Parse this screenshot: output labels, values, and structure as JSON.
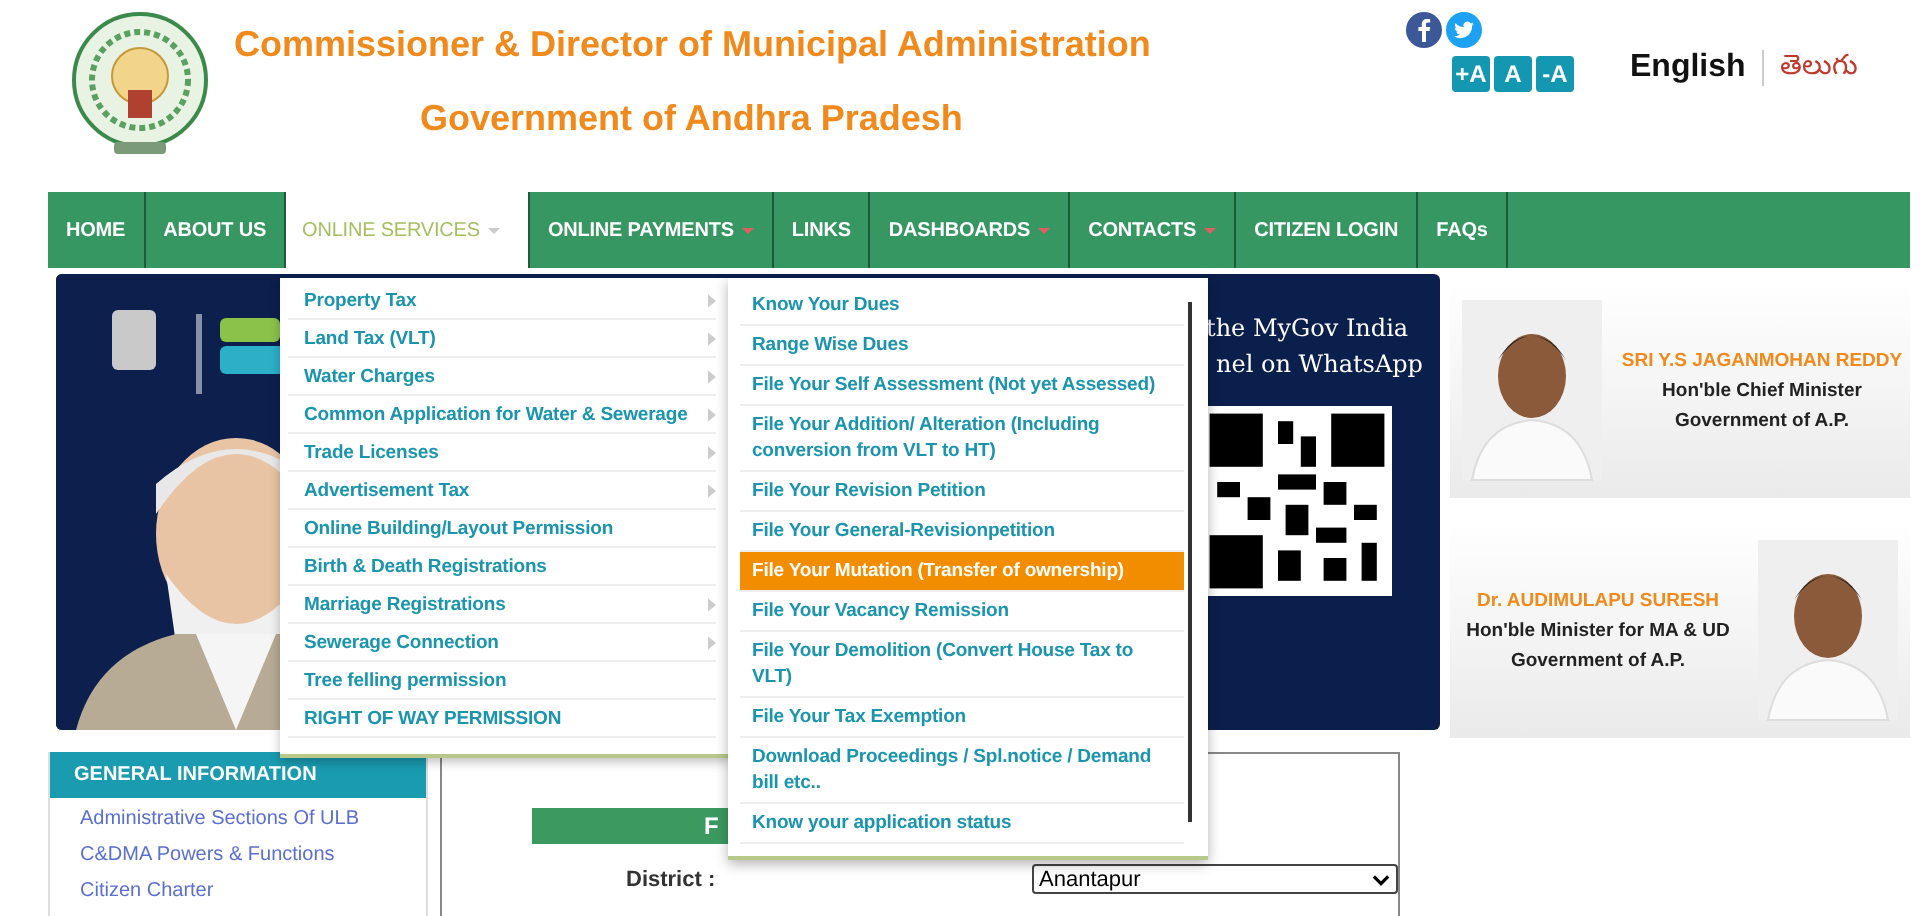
{
  "header": {
    "title": "Commissioner & Director of Municipal Administration",
    "subtitle": "Government of Andhra Pradesh",
    "font_buttons": [
      "+A",
      "A",
      "-A"
    ],
    "languages": [
      {
        "label": "English",
        "selected": true
      },
      {
        "label": "తెలుగు",
        "selected": false
      }
    ]
  },
  "nav": [
    {
      "label": "HOME",
      "selected": false,
      "has_dropdown": false
    },
    {
      "label": "ABOUT US",
      "selected": false,
      "has_dropdown": false
    },
    {
      "label": "ONLINE SERVICES",
      "selected": true,
      "has_dropdown": true
    },
    {
      "label": "ONLINE PAYMENTS",
      "selected": false,
      "has_dropdown": true
    },
    {
      "label": "LINKS",
      "selected": false,
      "has_dropdown": false
    },
    {
      "label": "DASHBOARDS",
      "selected": false,
      "has_dropdown": true
    },
    {
      "label": "CONTACTS",
      "selected": false,
      "has_dropdown": true
    },
    {
      "label": "CITIZEN LOGIN",
      "selected": false,
      "has_dropdown": false
    },
    {
      "label": "FAQs",
      "selected": false,
      "has_dropdown": false
    }
  ],
  "services_menu": [
    {
      "label": "Property Tax",
      "has_submenu": true
    },
    {
      "label": "Land Tax (VLT)",
      "has_submenu": true
    },
    {
      "label": "Water Charges",
      "has_submenu": true
    },
    {
      "label": "Common Application for Water & Sewerage",
      "has_submenu": true
    },
    {
      "label": "Trade Licenses",
      "has_submenu": true
    },
    {
      "label": "Advertisement Tax",
      "has_submenu": true
    },
    {
      "label": "Online Building/Layout Permission",
      "has_submenu": false
    },
    {
      "label": "Birth & Death Registrations",
      "has_submenu": false
    },
    {
      "label": "Marriage Registrations",
      "has_submenu": true
    },
    {
      "label": "Sewerage Connection",
      "has_submenu": true
    },
    {
      "label": "Tree felling permission",
      "has_submenu": false
    },
    {
      "label": "RIGHT OF WAY PERMISSION",
      "has_submenu": false
    }
  ],
  "property_tax_menu": [
    {
      "label": "Know Your Dues",
      "selected": false
    },
    {
      "label": "Range Wise Dues",
      "selected": false
    },
    {
      "label": "File Your Self Assessment (Not yet Assessed)",
      "selected": false
    },
    {
      "label": "File Your Addition/ Alteration (Including conversion from VLT to HT)",
      "selected": false
    },
    {
      "label": "File Your Revision Petition",
      "selected": false
    },
    {
      "label": "File Your General-Revisionpetition",
      "selected": false
    },
    {
      "label": "File Your Mutation (Transfer of ownership)",
      "selected": true
    },
    {
      "label": "File Your Vacancy Remission",
      "selected": false
    },
    {
      "label": "File Your Demolition (Convert House Tax to VLT)",
      "selected": false
    },
    {
      "label": "File Your Tax Exemption",
      "selected": false
    },
    {
      "label": "Download Proceedings / Spl.notice / Demand bill etc..",
      "selected": false
    },
    {
      "label": "Know your application status",
      "selected": false
    }
  ],
  "banner": {
    "lines": [
      "the MyGov India",
      "nel on WhatsApp"
    ]
  },
  "leaders": [
    {
      "name": "SRI Y.S JAGANMOHAN REDDY",
      "role": [
        "Hon'ble Chief Minister",
        "Government of A.P."
      ]
    },
    {
      "name": "Dr. AUDIMULAPU SURESH",
      "role": [
        "Hon'ble Minister for MA & UD",
        "Government of A.P."
      ]
    }
  ],
  "general_information": {
    "title": "GENERAL INFORMATION",
    "links": [
      "Administrative Sections Of ULB",
      "C&DMA Powers & Functions",
      "Citizen Charter"
    ]
  },
  "form": {
    "heading": "F",
    "district_label": "District :",
    "district_value": "Anantapur"
  }
}
